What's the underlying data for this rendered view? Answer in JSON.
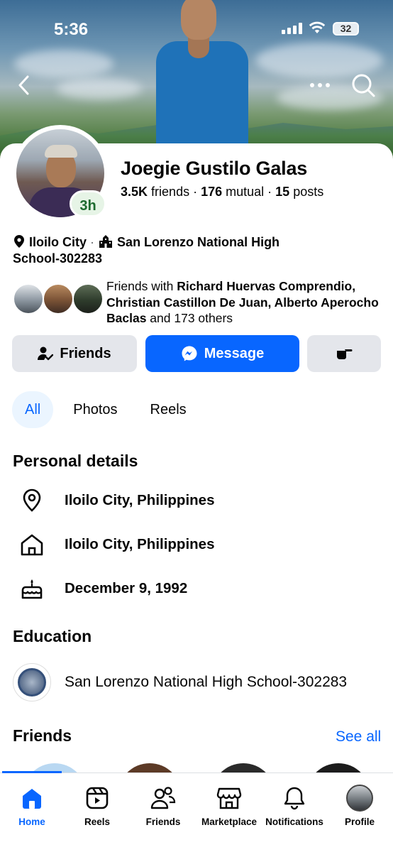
{
  "status_bar": {
    "time": "5:36",
    "battery": "32"
  },
  "cover": {
    "back_icon": "chevron-left-icon",
    "more_icon": "more-horizontal-icon",
    "search_icon": "search-icon"
  },
  "profile": {
    "name": "Joegie Gustilo Galas",
    "story_badge": "3h",
    "friends_count": "3.5K",
    "friends_word": "friends",
    "mutual_count": "176",
    "mutual_word": "mutual",
    "posts_count": "15",
    "posts_word": "posts",
    "location": "Iloilo City",
    "school_short": "San Lorenzo National High School-302283"
  },
  "mutual_friends": {
    "prefix": "Friends with ",
    "names": "Richard Huervas Comprendio, Christian Castillon De Juan, Alberto Aperocho Baclas",
    "suffix": " and 173 others"
  },
  "actions": {
    "friends_label": "Friends",
    "message_label": "Message"
  },
  "tabs": [
    {
      "label": "All",
      "active": true
    },
    {
      "label": "Photos",
      "active": false
    },
    {
      "label": "Reels",
      "active": false
    }
  ],
  "personal_details": {
    "heading": "Personal details",
    "items": [
      {
        "icon": "location-pin-icon",
        "text": "Iloilo City, Philippines"
      },
      {
        "icon": "home-icon",
        "text": "Iloilo City, Philippines"
      },
      {
        "icon": "birthday-cake-icon",
        "text": "December 9, 1992"
      }
    ]
  },
  "education": {
    "heading": "Education",
    "school": "San Lorenzo National High School-302283"
  },
  "friends_section": {
    "heading": "Friends",
    "see_all": "See all"
  },
  "bottom_nav": [
    {
      "label": "Home",
      "icon": "home-icon",
      "active": true
    },
    {
      "label": "Reels",
      "icon": "reels-icon",
      "active": false
    },
    {
      "label": "Friends",
      "icon": "friends-icon",
      "active": false
    },
    {
      "label": "Marketplace",
      "icon": "marketplace-icon",
      "active": false
    },
    {
      "label": "Notifications",
      "icon": "bell-icon",
      "active": false
    },
    {
      "label": "Profile",
      "icon": "profile-avatar",
      "active": false
    }
  ],
  "colors": {
    "accent": "#0866ff",
    "button_grey": "#e4e6eb",
    "story_badge_green": "#1d6b2f"
  }
}
